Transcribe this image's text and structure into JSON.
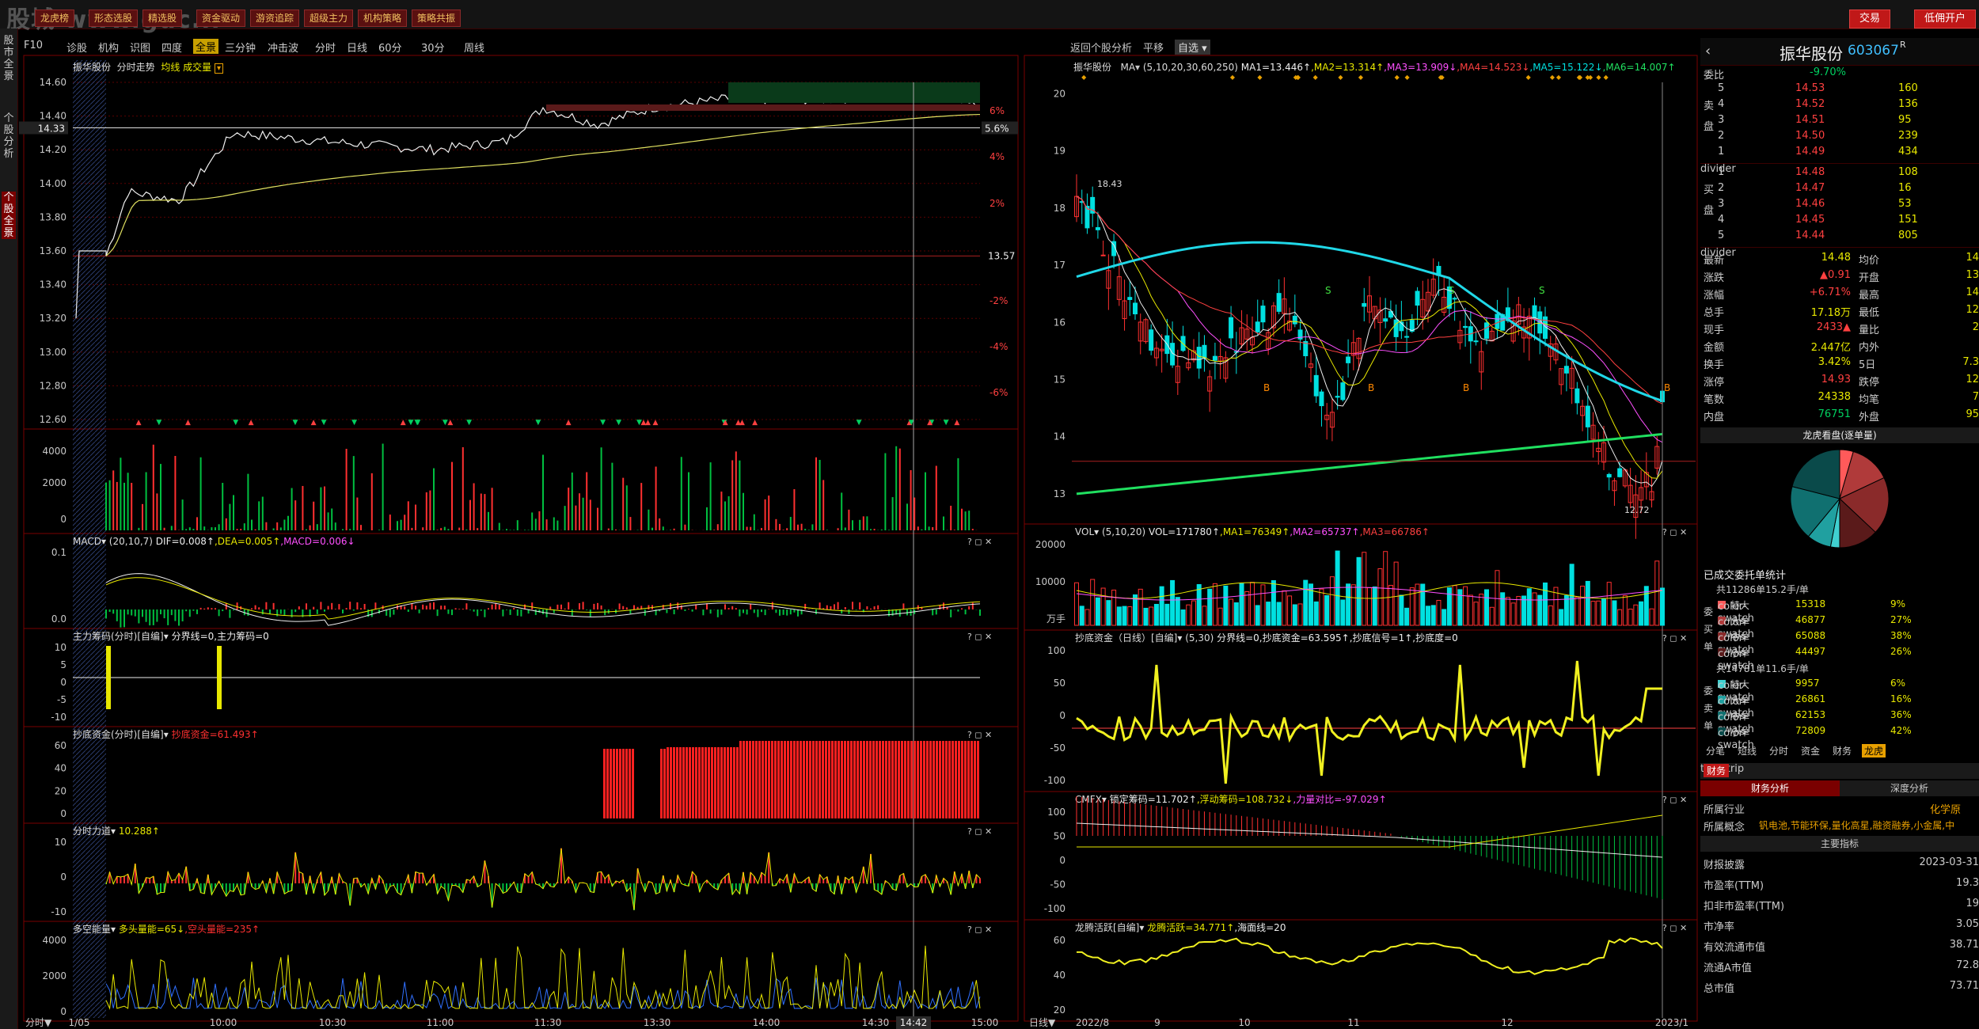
{
  "watermark": "股城 www.guc...",
  "topbar": {
    "buttons": [
      "龙虎榜",
      "形态选股",
      "精选股",
      "资金驱动",
      "游资追踪",
      "超级主力",
      "机构策略",
      "策略共振"
    ],
    "right_buttons": [
      "交易",
      "低佣开户"
    ]
  },
  "sidebar": {
    "tabs": [
      "股市全景",
      "个股分析",
      "个股全景"
    ]
  },
  "menu": {
    "items": [
      "F10",
      "诊股",
      "机构",
      "识图",
      "四度",
      "全景",
      "三分钟",
      "冲击波",
      "分时",
      "日线",
      "60分",
      "30分",
      "周线"
    ],
    "active": "全景",
    "right_items": [
      "返回个股分析",
      "平移",
      "自选"
    ]
  },
  "intraday": {
    "title": "振华股份",
    "subtitle": "分时走势",
    "legend": "均线 成交量",
    "price_labels": [
      "14.60",
      "14.40",
      "14.20",
      "14.00",
      "13.80",
      "13.60",
      "13.40",
      "13.20",
      "13.00",
      "12.80",
      "12.60"
    ],
    "pct_labels": [
      "6%",
      "4%",
      "2%",
      "",
      "-2%",
      "-4%",
      "-6%"
    ],
    "cursor_price": "14.33",
    "cursor_pct": "5.6%",
    "ref_label": "13.57",
    "vol_labels": [
      "4000",
      "2000",
      "0"
    ],
    "time_labels": [
      "1/05",
      "10:00",
      "10:30",
      "11:00",
      "11:30",
      "13:30",
      "14:00",
      "14:30",
      "15:00"
    ],
    "cursor_time": "14:42",
    "footer_label": "分时"
  },
  "ind_left": [
    {
      "name": "MACD",
      "params": "(20,10,7)",
      "vals": [
        {
          "t": "DIF=0.008↑",
          "c": "#eee"
        },
        {
          "t": ",DEA=0.005↑",
          "c": "#e8e800"
        },
        {
          "t": ",MACD=0.006↓",
          "c": "#ff50ff"
        }
      ],
      "labels": [
        "0.1",
        "0.0"
      ]
    },
    {
      "name": "主力筹码(分时)[自编]",
      "params": "",
      "vals": [
        {
          "t": "分界线=0,主力筹码=0",
          "c": "#eee"
        }
      ],
      "labels": [
        "10",
        "5",
        "0",
        "-5",
        "-10"
      ]
    },
    {
      "name": "抄底资金(分时)[自编]",
      "params": "",
      "vals": [
        {
          "t": "抄底资金=61.493↑",
          "c": "#ff3030"
        }
      ],
      "labels": [
        "60",
        "40",
        "20",
        "0"
      ]
    },
    {
      "name": "分时力道",
      "params": "",
      "vals": [
        {
          "t": "10.288↑",
          "c": "#e8e800"
        }
      ],
      "labels": [
        "10",
        "0",
        "-10"
      ]
    },
    {
      "name": "多空能量",
      "params": "",
      "vals": [
        {
          "t": "多头量能=65↓",
          "c": "#e8e800"
        },
        {
          "t": ",空头量能=235↑",
          "c": "#ff3030"
        }
      ],
      "labels": [
        "4000",
        "2000",
        "0"
      ]
    }
  ],
  "daily": {
    "title": "振华股份",
    "ma_label": "MA",
    "ma_params": "(5,10,20,30,60,250)",
    "ma_vals": [
      {
        "t": "MA1=13.446↑",
        "c": "#eee"
      },
      {
        "t": ",MA2=13.314↑",
        "c": "#e8e800"
      },
      {
        "t": ",MA3=13.909↓",
        "c": "#ff50ff"
      },
      {
        "t": ",MA4=14.523↓",
        "c": "#ff4040"
      },
      {
        "t": ",MA5=15.122↓",
        "c": "#00e0e0"
      },
      {
        "t": ",MA6=14.007↑",
        "c": "#20e060"
      }
    ],
    "price_labels": [
      "20",
      "19",
      "18",
      "17",
      "16",
      "15",
      "14",
      "13"
    ],
    "high_label": "18.43",
    "low_label": "12.72",
    "date_labels": [
      "2022/8",
      "9",
      "10",
      "11",
      "12",
      "2023/1"
    ],
    "footer_label": "日线"
  },
  "ind_right": [
    {
      "name": "VOL",
      "params": "(5,10,20)",
      "vals": [
        {
          "t": "VOL=171780↑",
          "c": "#eee"
        },
        {
          "t": ",MA1=76349↑",
          "c": "#e8e800"
        },
        {
          "t": ",MA2=65737↑",
          "c": "#ff50ff"
        },
        {
          "t": ",MA3=66786↑",
          "c": "#ff4040"
        }
      ],
      "labels": [
        "20000",
        "10000",
        "万手"
      ]
    },
    {
      "name": "抄底资金（日线）[自编]",
      "params": "(5,30)",
      "vals": [
        {
          "t": "分界线=0,抄底资金=63.595↑,抄底信号=1↑,抄底度=0",
          "c": "#eee"
        }
      ],
      "labels": [
        "100",
        "50",
        "0",
        "-50",
        "-100"
      ]
    },
    {
      "name": "CMFX",
      "params": "",
      "vals": [
        {
          "t": "锁定筹码=11.702↑",
          "c": "#eee"
        },
        {
          "t": ",浮动筹码=108.732↓",
          "c": "#e8e800"
        },
        {
          "t": ",力量对比=-97.029↑",
          "c": "#ff50ff"
        }
      ],
      "labels": [
        "100",
        "50",
        "0",
        "-50",
        "-100"
      ]
    },
    {
      "name": "龙腾活跃[自编]",
      "params": "",
      "vals": [
        {
          "t": "龙腾活跃=34.771↑",
          "c": "#e8e800"
        },
        {
          "t": ",海面线=20",
          "c": "#eee"
        }
      ],
      "labels": [
        "60",
        "40",
        "20"
      ]
    }
  ],
  "quote": {
    "name": "振华股份",
    "code": "603067",
    "flag": "R",
    "weibi_label": "委比",
    "weibi": "-9.70%",
    "asks": [
      {
        "l": "5",
        "p": "14.53",
        "v": "160"
      },
      {
        "l": "4",
        "p": "14.52",
        "v": "136"
      },
      {
        "l": "3",
        "p": "14.51",
        "v": "95"
      },
      {
        "l": "2",
        "p": "14.50",
        "v": "239"
      },
      {
        "l": "1",
        "p": "14.49",
        "v": "434"
      }
    ],
    "bids": [
      {
        "l": "1",
        "p": "14.48",
        "v": "108"
      },
      {
        "l": "2",
        "p": "14.47",
        "v": "16"
      },
      {
        "l": "3",
        "p": "14.46",
        "v": "53"
      },
      {
        "l": "4",
        "p": "14.45",
        "v": "151"
      },
      {
        "l": "5",
        "p": "14.44",
        "v": "805"
      }
    ],
    "ask_side": "卖盘",
    "bid_side": "买盘",
    "stats": [
      {
        "l": "最新",
        "v": "14.48",
        "l2": "均价",
        "v2": "14"
      },
      {
        "l": "涨跌",
        "v": "▲0.91",
        "l2": "开盘",
        "v2": "13"
      },
      {
        "l": "涨幅",
        "v": "+6.71%",
        "l2": "最高",
        "v2": "14"
      },
      {
        "l": "总手",
        "v": "17.18万",
        "l2": "最低",
        "v2": "12"
      },
      {
        "l": "现手",
        "v": "2433▲",
        "l2": "量比",
        "v2": "2"
      },
      {
        "l": "金额",
        "v": "2.447亿",
        "l2": "内外",
        "v2": ""
      },
      {
        "l": "换手",
        "v": "3.42%",
        "l2": "5日",
        "v2": "7.3"
      },
      {
        "l": "涨停",
        "v": "14.93",
        "l2": "跌停",
        "v2": "12"
      },
      {
        "l": "笔数",
        "v": "24338",
        "l2": "均笔",
        "v2": "7"
      },
      {
        "l": "内盘",
        "v": "76751",
        "l2": "外盘",
        "v2": "95"
      }
    ],
    "pie_title": "龙虎看盘(逐单量)",
    "order_title": "已成交委托单统计",
    "buy_total": "共11286单15.2手/单",
    "buy_side": "委买单",
    "buy_rows": [
      {
        "t": "特大",
        "v": "15318",
        "p": "9%"
      },
      {
        "t": "大单",
        "v": "46877",
        "p": "27%"
      },
      {
        "t": "中单",
        "v": "65088",
        "p": "38%"
      },
      {
        "t": "小单",
        "v": "44497",
        "p": "26%"
      }
    ],
    "sell_total": "共14781单11.6手/单",
    "sell_side": "委卖单",
    "sell_rows": [
      {
        "t": "特大",
        "v": "9957",
        "p": "6%"
      },
      {
        "t": "大单",
        "v": "26861",
        "p": "16%"
      },
      {
        "t": "中单",
        "v": "62153",
        "p": "36%"
      },
      {
        "t": "小单",
        "v": "72809",
        "p": "42%"
      }
    ],
    "tabs": [
      "分笔",
      "短线",
      "分时",
      "资金",
      "财务",
      "龙虎"
    ],
    "active_tab": "龙虎",
    "fin_tab": "财务",
    "sub_tabs": [
      "财务分析",
      "深度分析"
    ],
    "industry_label": "所属行业",
    "industry": "化学原",
    "concept_label": "所属概念",
    "concept": "钒电池,节能环保,量化高星,融资融券,小金属,中",
    "key_title": "主要指标",
    "metrics": [
      {
        "l": "财报披露",
        "v": "2023-03-31"
      },
      {
        "l": "市盈率(TTM)",
        "v": "19.3"
      },
      {
        "l": "扣非市盈率(TTM)",
        "v": "19"
      },
      {
        "l": "市净率",
        "v": "3.05"
      },
      {
        "l": "有效流通市值",
        "v": "38.71"
      },
      {
        "l": "流通A市值",
        "v": "72.8"
      },
      {
        "l": "总市值",
        "v": "73.71"
      }
    ]
  }
}
